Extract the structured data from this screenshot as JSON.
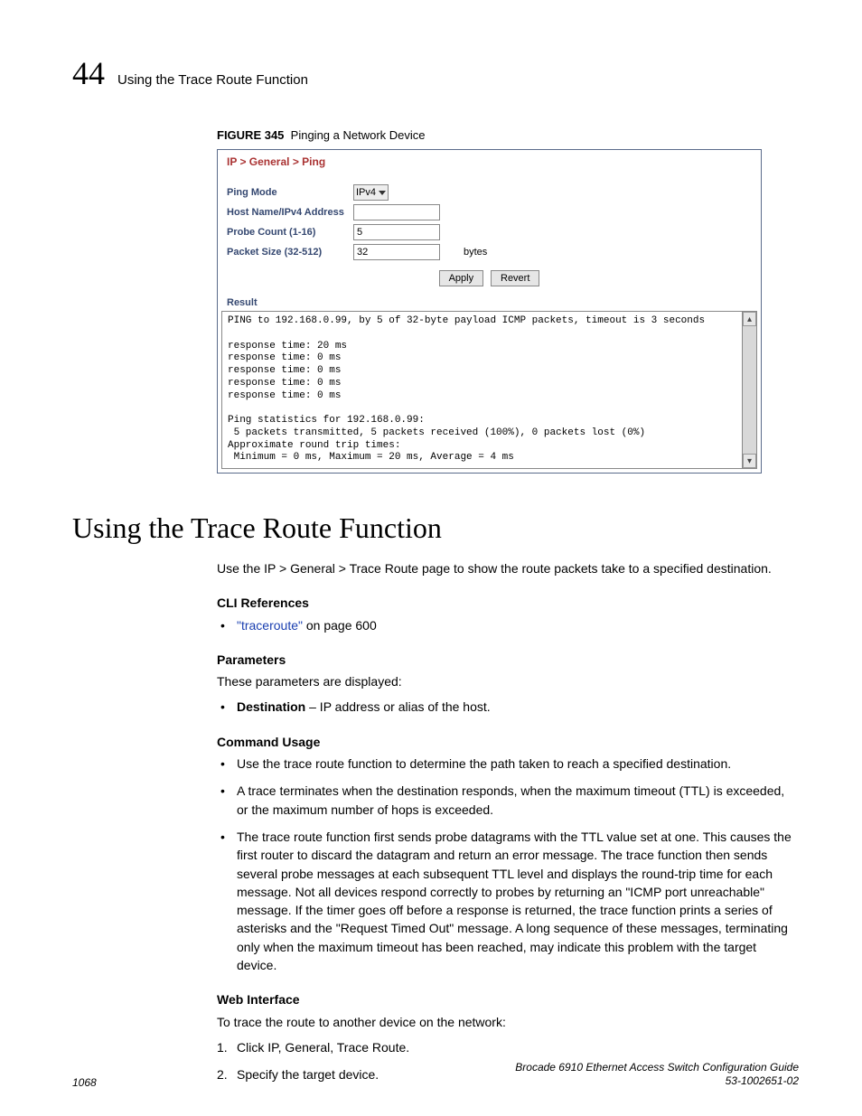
{
  "header": {
    "chapter_number": "44",
    "running_title": "Using the Trace Route Function"
  },
  "figure": {
    "label": "FIGURE 345",
    "caption": "Pinging a Network Device",
    "breadcrumb": "IP > General > Ping",
    "form": {
      "ping_mode_label": "Ping Mode",
      "ping_mode_value": "IPv4",
      "host_label": "Host Name/IPv4 Address",
      "host_value": "",
      "probe_label": "Probe Count (1-16)",
      "probe_value": "5",
      "size_label": "Packet Size (32-512)",
      "size_value": "32",
      "size_unit": "bytes",
      "apply_btn": "Apply",
      "revert_btn": "Revert"
    },
    "result_label": "Result",
    "result_text": "PING to 192.168.0.99, by 5 of 32-byte payload ICMP packets, timeout is 3 seconds\n\nresponse time: 20 ms\nresponse time: 0 ms\nresponse time: 0 ms\nresponse time: 0 ms\nresponse time: 0 ms\n\nPing statistics for 192.168.0.99:\n 5 packets transmitted, 5 packets received (100%), 0 packets lost (0%)\nApproximate round trip times:\n Minimum = 0 ms, Maximum = 20 ms, Average = 4 ms"
  },
  "section_heading": "Using the Trace Route Function",
  "intro_para": "Use the IP > General > Trace Route page to show the route packets take to a specified destination.",
  "cli_ref": {
    "heading": "CLI References",
    "link_text": "\"traceroute\"",
    "link_suffix": " on page 600"
  },
  "parameters": {
    "heading": "Parameters",
    "intro": "These parameters are displayed:",
    "item_bold": "Destination",
    "item_rest": " – IP address or alias of the host."
  },
  "command_usage": {
    "heading": "Command Usage",
    "items": [
      "Use the trace route function to determine the path taken to reach a specified destination.",
      "A trace terminates when the destination responds, when the maximum timeout (TTL) is exceeded, or the maximum number of hops is exceeded.",
      "The trace route function first sends probe datagrams with the TTL value set at one. This causes the first router to discard the datagram and return an error message. The trace function then sends several probe messages at each subsequent TTL level and displays the round-trip time for each message. Not all devices respond correctly to probes by returning an \"ICMP port unreachable\" message. If the timer goes off before a response is returned, the trace function prints a series of asterisks and the \"Request Timed Out\" message. A long sequence of these messages, terminating only when the maximum timeout has been reached, may indicate this problem with the target device."
    ]
  },
  "web_interface": {
    "heading": "Web Interface",
    "intro": "To trace the route to another device on the network:",
    "steps": [
      "Click IP, General, Trace Route.",
      "Specify the target device."
    ]
  },
  "footer": {
    "page_num": "1068",
    "doc_title": "Brocade 6910 Ethernet Access Switch Configuration Guide",
    "doc_id": "53-1002651-02"
  }
}
